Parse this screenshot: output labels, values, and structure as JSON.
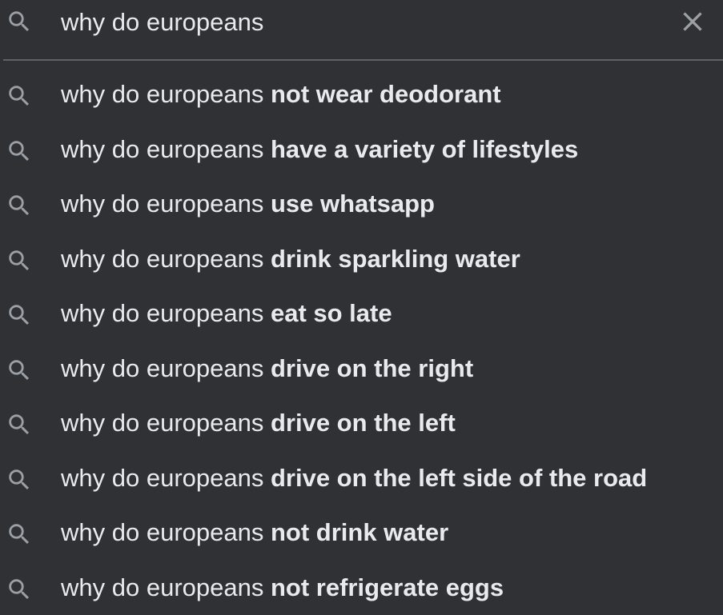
{
  "search": {
    "query": "why do europeans",
    "clear_icon": "close-icon",
    "search_icon": "search-icon"
  },
  "suggestions": [
    {
      "prefix": "why do europeans",
      "completion": "not wear deodorant"
    },
    {
      "prefix": "why do europeans",
      "completion": "have a variety of lifestyles"
    },
    {
      "prefix": "why do europeans",
      "completion": "use whatsapp"
    },
    {
      "prefix": "why do europeans",
      "completion": "drink sparkling water"
    },
    {
      "prefix": "why do europeans",
      "completion": "eat so late"
    },
    {
      "prefix": "why do europeans",
      "completion": "drive on the right"
    },
    {
      "prefix": "why do europeans",
      "completion": "drive on the left"
    },
    {
      "prefix": "why do europeans",
      "completion": "drive on the left side of the road"
    },
    {
      "prefix": "why do europeans",
      "completion": "not drink water"
    },
    {
      "prefix": "why do europeans",
      "completion": "not refrigerate eggs"
    }
  ],
  "colors": {
    "background": "#303134",
    "text": "#e8eaed",
    "icon": "#9aa0a6",
    "divider": "#5f6368"
  }
}
